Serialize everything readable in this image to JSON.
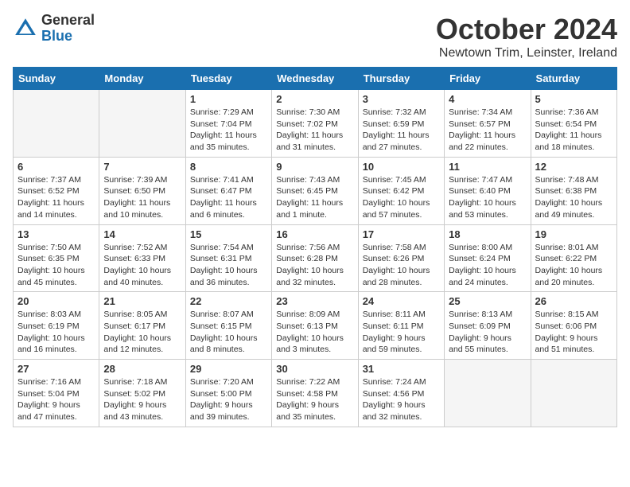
{
  "header": {
    "logo_general": "General",
    "logo_blue": "Blue",
    "month": "October 2024",
    "location": "Newtown Trim, Leinster, Ireland"
  },
  "weekdays": [
    "Sunday",
    "Monday",
    "Tuesday",
    "Wednesday",
    "Thursday",
    "Friday",
    "Saturday"
  ],
  "weeks": [
    [
      {
        "day": "",
        "info": ""
      },
      {
        "day": "",
        "info": ""
      },
      {
        "day": "1",
        "info": "Sunrise: 7:29 AM\nSunset: 7:04 PM\nDaylight: 11 hours\nand 35 minutes."
      },
      {
        "day": "2",
        "info": "Sunrise: 7:30 AM\nSunset: 7:02 PM\nDaylight: 11 hours\nand 31 minutes."
      },
      {
        "day": "3",
        "info": "Sunrise: 7:32 AM\nSunset: 6:59 PM\nDaylight: 11 hours\nand 27 minutes."
      },
      {
        "day": "4",
        "info": "Sunrise: 7:34 AM\nSunset: 6:57 PM\nDaylight: 11 hours\nand 22 minutes."
      },
      {
        "day": "5",
        "info": "Sunrise: 7:36 AM\nSunset: 6:54 PM\nDaylight: 11 hours\nand 18 minutes."
      }
    ],
    [
      {
        "day": "6",
        "info": "Sunrise: 7:37 AM\nSunset: 6:52 PM\nDaylight: 11 hours\nand 14 minutes."
      },
      {
        "day": "7",
        "info": "Sunrise: 7:39 AM\nSunset: 6:50 PM\nDaylight: 11 hours\nand 10 minutes."
      },
      {
        "day": "8",
        "info": "Sunrise: 7:41 AM\nSunset: 6:47 PM\nDaylight: 11 hours\nand 6 minutes."
      },
      {
        "day": "9",
        "info": "Sunrise: 7:43 AM\nSunset: 6:45 PM\nDaylight: 11 hours\nand 1 minute."
      },
      {
        "day": "10",
        "info": "Sunrise: 7:45 AM\nSunset: 6:42 PM\nDaylight: 10 hours\nand 57 minutes."
      },
      {
        "day": "11",
        "info": "Sunrise: 7:47 AM\nSunset: 6:40 PM\nDaylight: 10 hours\nand 53 minutes."
      },
      {
        "day": "12",
        "info": "Sunrise: 7:48 AM\nSunset: 6:38 PM\nDaylight: 10 hours\nand 49 minutes."
      }
    ],
    [
      {
        "day": "13",
        "info": "Sunrise: 7:50 AM\nSunset: 6:35 PM\nDaylight: 10 hours\nand 45 minutes."
      },
      {
        "day": "14",
        "info": "Sunrise: 7:52 AM\nSunset: 6:33 PM\nDaylight: 10 hours\nand 40 minutes."
      },
      {
        "day": "15",
        "info": "Sunrise: 7:54 AM\nSunset: 6:31 PM\nDaylight: 10 hours\nand 36 minutes."
      },
      {
        "day": "16",
        "info": "Sunrise: 7:56 AM\nSunset: 6:28 PM\nDaylight: 10 hours\nand 32 minutes."
      },
      {
        "day": "17",
        "info": "Sunrise: 7:58 AM\nSunset: 6:26 PM\nDaylight: 10 hours\nand 28 minutes."
      },
      {
        "day": "18",
        "info": "Sunrise: 8:00 AM\nSunset: 6:24 PM\nDaylight: 10 hours\nand 24 minutes."
      },
      {
        "day": "19",
        "info": "Sunrise: 8:01 AM\nSunset: 6:22 PM\nDaylight: 10 hours\nand 20 minutes."
      }
    ],
    [
      {
        "day": "20",
        "info": "Sunrise: 8:03 AM\nSunset: 6:19 PM\nDaylight: 10 hours\nand 16 minutes."
      },
      {
        "day": "21",
        "info": "Sunrise: 8:05 AM\nSunset: 6:17 PM\nDaylight: 10 hours\nand 12 minutes."
      },
      {
        "day": "22",
        "info": "Sunrise: 8:07 AM\nSunset: 6:15 PM\nDaylight: 10 hours\nand 8 minutes."
      },
      {
        "day": "23",
        "info": "Sunrise: 8:09 AM\nSunset: 6:13 PM\nDaylight: 10 hours\nand 3 minutes."
      },
      {
        "day": "24",
        "info": "Sunrise: 8:11 AM\nSunset: 6:11 PM\nDaylight: 9 hours\nand 59 minutes."
      },
      {
        "day": "25",
        "info": "Sunrise: 8:13 AM\nSunset: 6:09 PM\nDaylight: 9 hours\nand 55 minutes."
      },
      {
        "day": "26",
        "info": "Sunrise: 8:15 AM\nSunset: 6:06 PM\nDaylight: 9 hours\nand 51 minutes."
      }
    ],
    [
      {
        "day": "27",
        "info": "Sunrise: 7:16 AM\nSunset: 5:04 PM\nDaylight: 9 hours\nand 47 minutes."
      },
      {
        "day": "28",
        "info": "Sunrise: 7:18 AM\nSunset: 5:02 PM\nDaylight: 9 hours\nand 43 minutes."
      },
      {
        "day": "29",
        "info": "Sunrise: 7:20 AM\nSunset: 5:00 PM\nDaylight: 9 hours\nand 39 minutes."
      },
      {
        "day": "30",
        "info": "Sunrise: 7:22 AM\nSunset: 4:58 PM\nDaylight: 9 hours\nand 35 minutes."
      },
      {
        "day": "31",
        "info": "Sunrise: 7:24 AM\nSunset: 4:56 PM\nDaylight: 9 hours\nand 32 minutes."
      },
      {
        "day": "",
        "info": ""
      },
      {
        "day": "",
        "info": ""
      }
    ]
  ]
}
